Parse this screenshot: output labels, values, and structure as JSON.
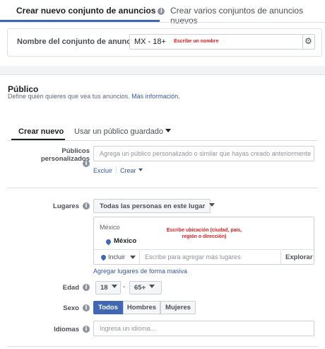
{
  "tabs": [
    {
      "label": "Crear nuevo conjunto de anuncios",
      "active": true,
      "icon": "info-icon"
    },
    {
      "label": "Crear varios conjuntos de anuncios nuevos",
      "active": false
    }
  ],
  "ad_set_name": {
    "label": "Nombre del conjunto de anuncios",
    "value": "MX - 18+",
    "annotation": "Escribe un nombre",
    "settings_icon": "gear-icon"
  },
  "audience": {
    "title": "Público",
    "subtitle": "Define quién quieres que vea tus anuncios.",
    "subtitle_link": "Más información.",
    "tabs": [
      {
        "label": "Crear nuevo",
        "active": true
      },
      {
        "label": "Usar un público guardado",
        "active": false
      }
    ],
    "custom_audiences": {
      "label": "Públicos personalizados",
      "placeholder": "Agrega un público personalizado o similar que hayas creado anteriormente",
      "exclude": "Excluir",
      "create": "Crear"
    },
    "locations": {
      "label": "Lugares",
      "dropdown": "Todas las personas en este lugar",
      "country": "México",
      "annotation": "Escribe ubicación (ciudad, país, región o dirección)",
      "selected": "México",
      "include": "Incluir",
      "search_placeholder": "Escribe para agregar más lugares",
      "explore": "Explorar",
      "bulk_link": "Agregar lugares de forma masiva"
    },
    "age": {
      "label": "Edad",
      "min": "18",
      "max": "65+"
    },
    "gender": {
      "label": "Sexo",
      "options": [
        "Todos",
        "Hombres",
        "Mujeres"
      ],
      "selected": "Todos"
    },
    "languages": {
      "label": "Idiomas",
      "placeholder": "Ingresa un idioma..."
    }
  },
  "colors": {
    "accent": "#4267b2",
    "link": "#385898",
    "annotation": "#e02020"
  }
}
